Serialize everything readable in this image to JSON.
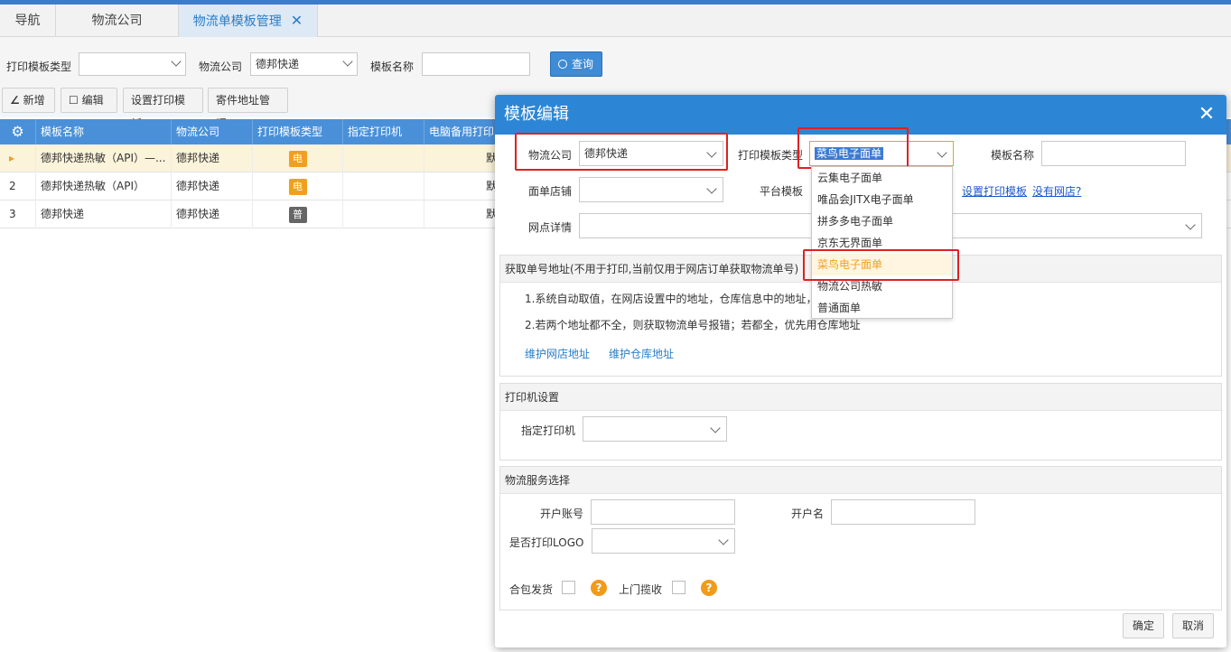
{
  "tabs": [
    {
      "label": "导航"
    },
    {
      "label": "物流公司"
    },
    {
      "label": "物流单模板管理"
    }
  ],
  "filter": {
    "type_label": "打印模板类型",
    "type_value": "",
    "company_label": "物流公司",
    "company_value": "德邦快递",
    "name_label": "模板名称",
    "name_value": "",
    "query_label": "查询"
  },
  "toolbar": {
    "add_label": "新增",
    "edit_label": "编辑",
    "set_template_label": "设置打印模板",
    "sender_address_label": "寄件地址管理"
  },
  "grid": {
    "columns": [
      "模板名称",
      "物流公司",
      "打印模板类型",
      "指定打印机",
      "电脑备用打印"
    ],
    "rows": [
      {
        "index": "▸",
        "name": "德邦快递热敏（API）—...",
        "company": "德邦快递",
        "type_badge": "电",
        "badge_color": "#f0a020",
        "extra": "默"
      },
      {
        "index": "2",
        "name": "德邦快递热敏（API）",
        "company": "德邦快递",
        "type_badge": "电",
        "badge_color": "#f0a020",
        "extra": "默"
      },
      {
        "index": "3",
        "name": "德邦快递",
        "company": "德邦快递",
        "type_badge": "普",
        "badge_color": "#666666",
        "extra": "默"
      }
    ]
  },
  "modal": {
    "title": "模板编辑",
    "close": "✕",
    "company_label": "物流公司",
    "company_value": "德邦快递",
    "type_label": "打印模板类型",
    "type_value": "菜鸟电子面单",
    "name_label": "模板名称",
    "name_value": "",
    "shop_label": "面单店铺",
    "shop_value": "",
    "platform_label": "平台模板",
    "set_template_link": "设置打印模板",
    "no_shop_link": "没有网店?",
    "outlet_label": "网点详情",
    "outlet_value": "",
    "address_section": {
      "title": "获取单号地址(不用于打印,当前仅用于网店订单获取物流单号)",
      "line1": "1.系统自动取值，在网店设置中的地址，仓库信息中的地址，",
      "line2": "2.若两个地址都不全，则获取物流单号报错；若都全，优先用仓库地址",
      "link_shop": "维护网店地址",
      "link_warehouse": "维护仓库地址"
    },
    "printer_section": {
      "title": "打印机设置",
      "printer_label": "指定打印机",
      "printer_value": ""
    },
    "service_section": {
      "title": "物流服务选择",
      "account_label": "开户账号",
      "account_value": "",
      "holder_label": "开户名",
      "holder_value": "",
      "logo_label": "是否打印LOGO",
      "logo_value": ""
    },
    "merge_label": "合包发货",
    "pickup_label": "上门揽收",
    "help_glyph": "?",
    "ok_label": "确定",
    "cancel_label": "取消"
  },
  "dropdown": {
    "options": [
      "云集电子面单",
      "唯品会JITX电子面单",
      "拼多多电子面单",
      "京东无界面单",
      "菜鸟电子面单",
      "物流公司热敏",
      "普通面单"
    ],
    "selected": "菜鸟电子面单"
  },
  "colors": {
    "accent": "#2d86d5",
    "highlight": "#e02020",
    "selected_option": "#f0a020"
  }
}
